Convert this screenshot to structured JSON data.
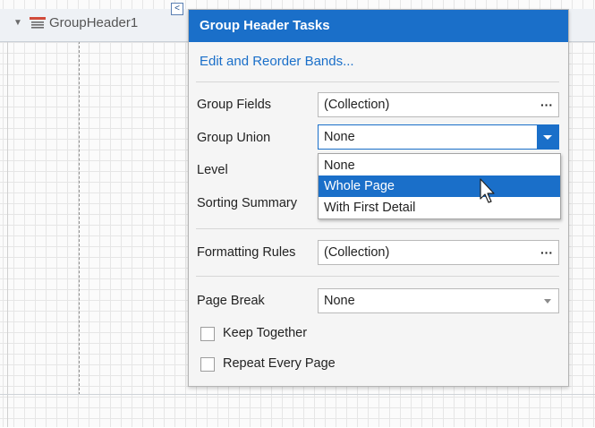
{
  "band": {
    "name": "GroupHeader1",
    "caret_icon": "triangle-down",
    "icon": "group-header-band-icon",
    "smart_tag_glyph": "<"
  },
  "panel": {
    "title": "Group Header Tasks",
    "link": "Edit and Reorder Bands...",
    "group_fields": {
      "label": "Group Fields",
      "value": "(Collection)",
      "button": "···"
    },
    "group_union": {
      "label": "Group Union",
      "value": "None"
    },
    "level": {
      "label": "Level"
    },
    "sorting_summary": {
      "label": "Sorting Summary"
    },
    "formatting_rules": {
      "label": "Formatting Rules",
      "value": "(Collection)",
      "button": "···"
    },
    "page_break": {
      "label": "Page Break",
      "value": "None"
    },
    "keep_together": {
      "label": "Keep Together",
      "checked": false
    },
    "repeat_every_page": {
      "label": "Repeat Every Page",
      "checked": false
    }
  },
  "dropdown": {
    "options": [
      "None",
      "Whole Page",
      "With First Detail"
    ],
    "highlighted": "Whole Page"
  },
  "colors": {
    "accent": "#1a6fc9",
    "panel_bg": "#f5f5f5",
    "band_bg": "#eef1f5"
  }
}
